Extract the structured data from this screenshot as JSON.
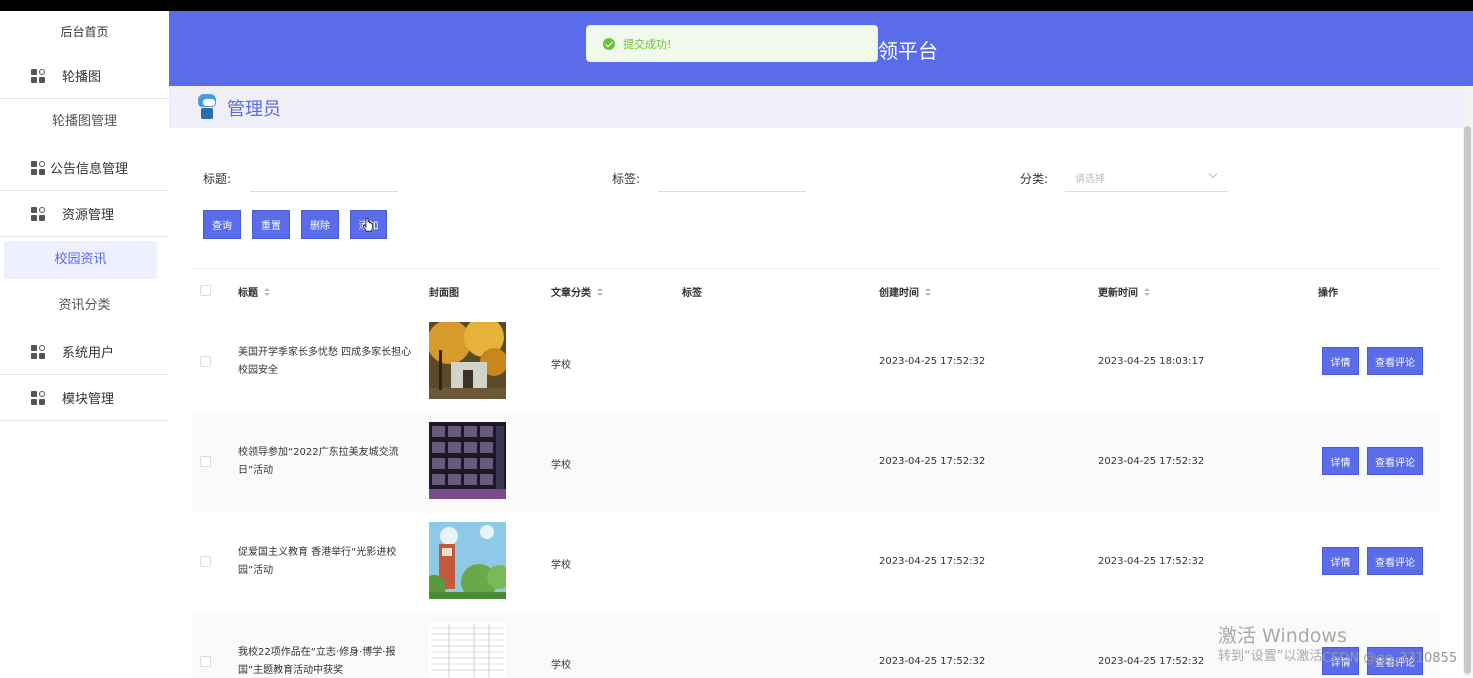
{
  "sidebar": {
    "home": "后台首页",
    "carousel": "轮播图",
    "carousel_manage": "轮播图管理",
    "notice_manage": "公告信息管理",
    "resource_manage": "资源管理",
    "campus_news": "校园资讯",
    "news_category": "资讯分类",
    "system_users": "系统用户",
    "module_manage": "模块管理"
  },
  "header": {
    "title": "领平台"
  },
  "toast": {
    "message": "提交成功!"
  },
  "breadcrumb": {
    "role": "管理员"
  },
  "filters": {
    "title_label": "标题:",
    "tag_label": "标签:",
    "category_label": "分类:",
    "category_placeholder": "请选择"
  },
  "buttons": {
    "query": "查询",
    "reset": "重置",
    "delete": "删除",
    "add": "添加"
  },
  "table": {
    "columns": {
      "title": "标题",
      "cover": "封面图",
      "category": "文章分类",
      "tag": "标签",
      "created": "创建时间",
      "updated": "更新时间",
      "actions": "操作"
    },
    "detail_label": "详情",
    "comments_label": "查看评论",
    "rows": [
      {
        "title": "美国开学季家长多忧愁 四成多家长担心校园安全",
        "category": "学校",
        "created": "2023-04-25 17:52:32",
        "updated": "2023-04-25 18:03:17",
        "cover": "autumn-campus"
      },
      {
        "title": "校领导参加“2022广东拉美友城交流日”活动",
        "category": "学校",
        "created": "2023-04-25 17:52:32",
        "updated": "2023-04-25 17:52:32",
        "cover": "video-conference"
      },
      {
        "title": "促爱国主义教育 香港举行“光影进校园”活动",
        "category": "学校",
        "created": "2023-04-25 17:52:32",
        "updated": "2023-04-25 17:52:32",
        "cover": "clock-tower"
      },
      {
        "title": "我校22项作品在“立志·修身·博学·报国”主题教育活动中获奖",
        "category": "学校",
        "created": "2023-04-25 17:52:32",
        "updated": "2023-04-25 17:52:32",
        "cover": "document-table"
      }
    ]
  },
  "watermark": {
    "line1": "激活 Windows",
    "line2": "转到“设置”以激活",
    "csdn": "CSDN @qq_3310855"
  },
  "colors": {
    "primary": "#5b6ceb",
    "success": "#67c23a"
  }
}
